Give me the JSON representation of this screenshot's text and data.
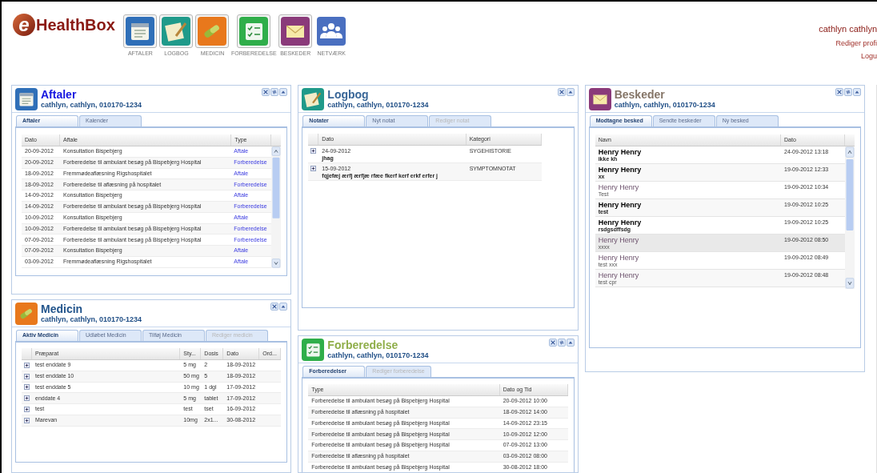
{
  "header": {
    "logo": {
      "mark": "e",
      "name": "HealthBox"
    },
    "nav": [
      {
        "label": "AFTALER"
      },
      {
        "label": "LOGBOG"
      },
      {
        "label": "MEDICIN"
      },
      {
        "label": "FORBEREDELSE"
      },
      {
        "label": "BESKEDER"
      },
      {
        "label": "NETVÆRK"
      }
    ],
    "user": {
      "name": "cathlyn cathlyn",
      "links": [
        "Rediger profi",
        "Logu"
      ]
    }
  },
  "columns": [
    [
      {
        "kind": "appointments",
        "title": "Aftaler",
        "subtitle": "cathlyn, cathlyn, 010170-1234",
        "tabs": [
          {
            "label": "Aftaler",
            "selected": true,
            "disabled": false
          },
          {
            "label": "Kalender",
            "selected": false,
            "disabled": false
          }
        ],
        "grid": {
          "columns": [
            "Dato",
            "Aftale",
            "Type"
          ],
          "rows": [
            {
              "cells": [
                "20-09-2012",
                "Konsultation Bispebjerg",
                "Aftale"
              ]
            },
            {
              "cells": [
                "20-09-2012",
                "Forberedelse til ambulant besøg på Bispebjerg Hospital",
                "Forberedelse"
              ]
            },
            {
              "cells": [
                "18-09-2012",
                "Fremmødeaflæsning Rigshospitalet",
                "Aftale"
              ]
            },
            {
              "cells": [
                "18-09-2012",
                "Forberedelse til aflæsning på hospitalet",
                "Forberedelse"
              ]
            },
            {
              "cells": [
                "14-09-2012",
                "Konsultation Bispebjerg",
                "Aftale"
              ]
            },
            {
              "cells": [
                "14-09-2012",
                "Forberedelse til ambulant besøg på Bispebjerg Hospital",
                "Forberedelse"
              ]
            },
            {
              "cells": [
                "10-09-2012",
                "Konsultation Bispebjerg",
                "Aftale"
              ]
            },
            {
              "cells": [
                "10-09-2012",
                "Forberedelse til ambulant besøg på Bispebjerg Hospital",
                "Forberedelse"
              ]
            },
            {
              "cells": [
                "07-09-2012",
                "Forberedelse til ambulant besøg på Bispebjerg Hospital",
                "Forberedelse"
              ]
            },
            {
              "cells": [
                "07-09-2012",
                "Konsultation Bispebjerg",
                "Aftale"
              ]
            },
            {
              "cells": [
                "03-09-2012",
                "Fremmødeaflæsning Rigshospitalet",
                "Aftale"
              ]
            }
          ]
        }
      },
      {
        "kind": "medicine",
        "title": "Medicin",
        "subtitle": "cathlyn, cathlyn, 010170-1234",
        "tabs": [
          {
            "label": "Aktiv Medicin",
            "selected": true,
            "disabled": false
          },
          {
            "label": "Udløbet Medicin",
            "selected": false,
            "disabled": false
          },
          {
            "label": "Tilføj Medicin",
            "selected": false,
            "disabled": false
          },
          {
            "label": "Rediger medicin",
            "selected": false,
            "disabled": true
          }
        ],
        "grid": {
          "columns": [
            "Præparat",
            "Sty...",
            "Dosis",
            "Dato",
            "Ord..."
          ],
          "rows": [
            {
              "expanded": false,
              "cells": [
                "test enddate 9",
                "5 mg",
                "2",
                "18-09-2012"
              ]
            },
            {
              "expanded": false,
              "cells": [
                "test enddate 10",
                "50 mg",
                "5",
                "18-09-2012"
              ]
            },
            {
              "expanded": false,
              "cells": [
                "test enddate 5",
                "10 mg",
                "1 dgl",
                "17-09-2012"
              ]
            },
            {
              "expanded": false,
              "cells": [
                "enddate 4",
                "5 mg",
                "tablet",
                "17-09-2012"
              ]
            },
            {
              "expanded": false,
              "cells": [
                "test",
                "test",
                "tset",
                "16-09-2012"
              ]
            },
            {
              "expanded": false,
              "cells": [
                "Marevan",
                "10mg",
                "2x1...",
                "30-08-2012"
              ]
            }
          ]
        }
      }
    ],
    [
      {
        "kind": "log",
        "title": "Logbog",
        "subtitle": "cathlyn, cathlyn, 010170-1234",
        "tabs": [
          {
            "label": "Notater",
            "selected": true,
            "disabled": false
          },
          {
            "label": "Nyt notat",
            "selected": false,
            "disabled": false
          },
          {
            "label": "Rediger notat",
            "selected": false,
            "disabled": true
          }
        ],
        "grid": {
          "columns": [
            "Dato",
            "Kategori"
          ],
          "rows": [
            {
              "expanded": false,
              "date": "24-09-2012",
              "note": "jhag",
              "category": "SYGEHISTORIE"
            },
            {
              "expanded": false,
              "date": "15-09-2012",
              "note": "fqjefæj ærfj ærfjæ rfæe fkerf kerf erkf erfer j",
              "category": "SYMPTOMNOTAT"
            }
          ]
        }
      },
      {
        "kind": "preparations",
        "title": "Forberedelse",
        "subtitle": "cathlyn, cathlyn, 010170-1234",
        "tabs": [
          {
            "label": "Forberedelser",
            "selected": true,
            "disabled": false
          },
          {
            "label": "Rediger forberedelse",
            "selected": false,
            "disabled": true
          }
        ],
        "grid": {
          "columns": [
            "Type",
            "Dato og Tid"
          ],
          "rows": [
            {
              "cells": [
                "Forberedelse til ambulant besøg på Bispebjerg Hospital",
                "20-09-2012 10:00"
              ]
            },
            {
              "cells": [
                "Forberedelse til aflæsning på hospitalet",
                "18-09-2012 14:00"
              ]
            },
            {
              "cells": [
                "Forberedelse til ambulant besøg på Bispebjerg Hospital",
                "14-09-2012 23:15"
              ]
            },
            {
              "cells": [
                "Forberedelse til ambulant besøg på Bispebjerg Hospital",
                "10-09-2012 12:00"
              ]
            },
            {
              "cells": [
                "Forberedelse til ambulant besøg på Bispebjerg Hospital",
                "07-09-2012 13:00"
              ]
            },
            {
              "cells": [
                "Forberedelse til aflæsning på hospitalet",
                "03-09-2012 08:00"
              ]
            },
            {
              "cells": [
                "Forberedelse til ambulant besøg på Bispebjerg Hospital",
                "30-08-2012 18:00"
              ]
            }
          ]
        }
      }
    ],
    [
      {
        "kind": "messages",
        "title": "Beskeder",
        "subtitle": "cathlyn, cathlyn, 010170-1234",
        "tabs": [
          {
            "label": "Modtagne besked",
            "selected": true,
            "disabled": false
          },
          {
            "label": "Sendte beskeder",
            "selected": false,
            "disabled": false
          },
          {
            "label": "Ny besked",
            "selected": false,
            "disabled": false
          }
        ],
        "grid": {
          "columns": [
            "Navn",
            "Dato"
          ],
          "rows": [
            {
              "name": "Henry Henry",
              "subject": "ikke kh",
              "date": "24-09-2012 13:18",
              "unread": true,
              "selected": false
            },
            {
              "name": "Henry Henry",
              "subject": "xx",
              "date": "19-09-2012 12:33",
              "unread": true,
              "selected": false
            },
            {
              "name": "Henry Henry",
              "subject": "Test",
              "date": "19-09-2012 10:34",
              "unread": false,
              "selected": false
            },
            {
              "name": "Henry Henry",
              "subject": "test",
              "date": "19-09-2012 10:25",
              "unread": true,
              "selected": false
            },
            {
              "name": "Henry Henry",
              "subject": "rsdgsdffsdg",
              "date": "19-09-2012 10:25",
              "unread": true,
              "selected": false
            },
            {
              "name": "Henry Henry",
              "subject": "xxxx",
              "date": "19-09-2012 08:50",
              "unread": false,
              "selected": true
            },
            {
              "name": "Henry Henry",
              "subject": "test xxx",
              "date": "19-09-2012 08:49",
              "unread": false,
              "selected": false
            },
            {
              "name": "Henry Henry",
              "subject": "test cpr",
              "date": "19-09-2012 08:48",
              "unread": false,
              "selected": false
            }
          ]
        }
      }
    ]
  ]
}
